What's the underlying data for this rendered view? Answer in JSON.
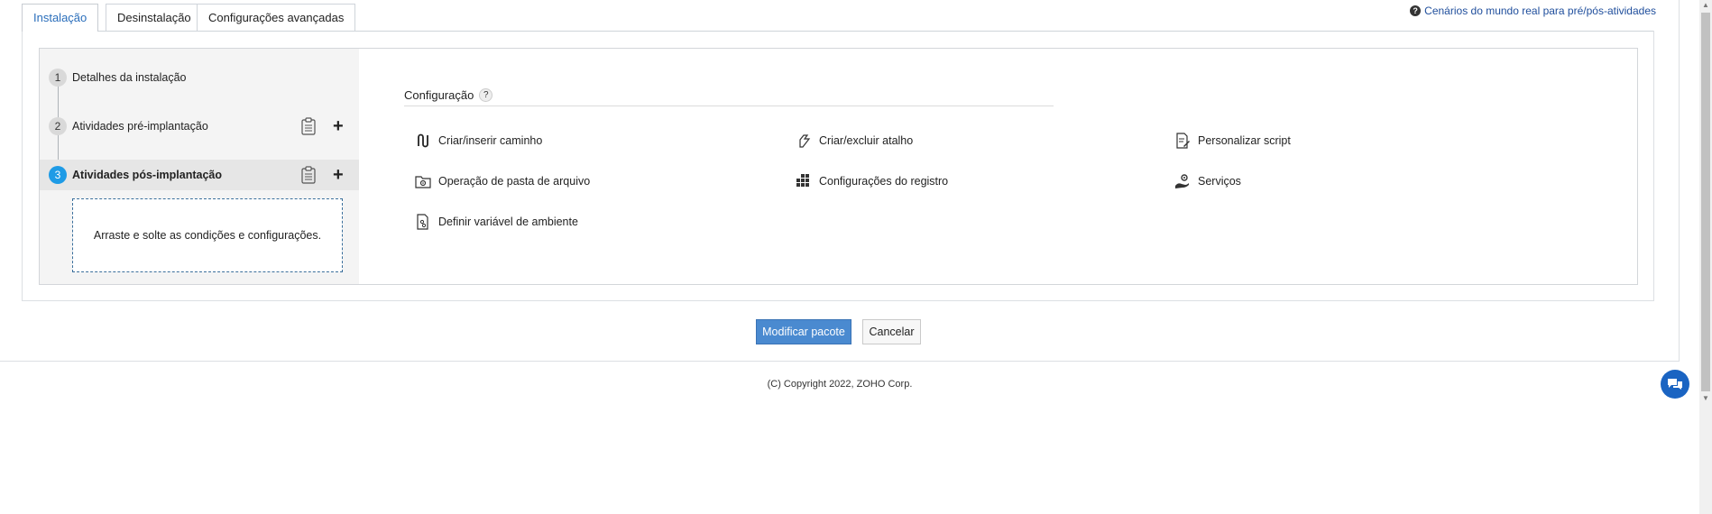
{
  "tabs": [
    {
      "label": "Instalação",
      "active": true
    },
    {
      "label": "Desinstalação",
      "active": false
    },
    {
      "label": "Configurações avançadas",
      "active": false
    }
  ],
  "help_link": "Cenários do mundo real para pré/pós-atividades",
  "steps": [
    {
      "number": "1",
      "label": "Detalhes da instalação"
    },
    {
      "number": "2",
      "label": "Atividades pré-implantação"
    },
    {
      "number": "3",
      "label": "Atividades pós-implantação"
    }
  ],
  "dropzone_text": "Arraste e solte as condições e configurações.",
  "config": {
    "title": "Configuração",
    "help": "?",
    "items": [
      {
        "label": "Criar/inserir caminho",
        "icon": "path-icon"
      },
      {
        "label": "Criar/excluir atalho",
        "icon": "shortcut-icon"
      },
      {
        "label": "Personalizar script",
        "icon": "script-icon"
      },
      {
        "label": "Operação de pasta de arquivo",
        "icon": "folder-gear-icon"
      },
      {
        "label": "Configurações do registro",
        "icon": "registry-icon"
      },
      {
        "label": "Serviços",
        "icon": "services-icon"
      },
      {
        "label": "Definir variável de ambiente",
        "icon": "env-variable-icon"
      }
    ]
  },
  "buttons": {
    "modify": "Modificar pacote",
    "cancel": "Cancelar"
  },
  "footer": {
    "copyright": "(C) Copyright 2022, ZOHO Corp."
  },
  "colors": {
    "accent": "#1e9be6",
    "primary_button": "#4a8ad0",
    "tab_active_text": "#2a6ebb"
  }
}
